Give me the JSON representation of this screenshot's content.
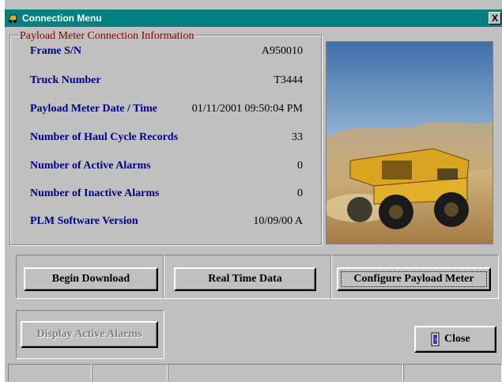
{
  "window": {
    "title": "Connection Menu",
    "close_glyph": "X",
    "icon": "mining-truck-icon"
  },
  "info_group": {
    "legend": "Payload Meter Connection Information",
    "rows": [
      {
        "label": "Frame S/N",
        "value": "A950010"
      },
      {
        "label": "Truck Number",
        "value": "T3444"
      },
      {
        "label": "Payload Meter Date / Time",
        "value": "01/11/2001 09:50:04 PM"
      },
      {
        "label": "Number of Haul Cycle Records",
        "value": "33"
      },
      {
        "label": "Number of Active Alarms",
        "value": "0"
      },
      {
        "label": "Number of Inactive Alarms",
        "value": "0"
      },
      {
        "label": "PLM Software Version",
        "value": "10/09/00 A"
      }
    ]
  },
  "photo": {
    "subject": "haul-truck-photo"
  },
  "buttons": {
    "begin_download": "Begin Download",
    "real_time_data": "Real Time Data",
    "configure_payload_meter": "Configure Payload Meter",
    "display_active_alarms": "Display Active Alarms",
    "close": "Close",
    "close_icon": "door-exit-icon"
  },
  "colors": {
    "titlebar": "#008080",
    "label_text": "#000080",
    "legend_text": "#800000",
    "face": "#c0c0c0"
  }
}
